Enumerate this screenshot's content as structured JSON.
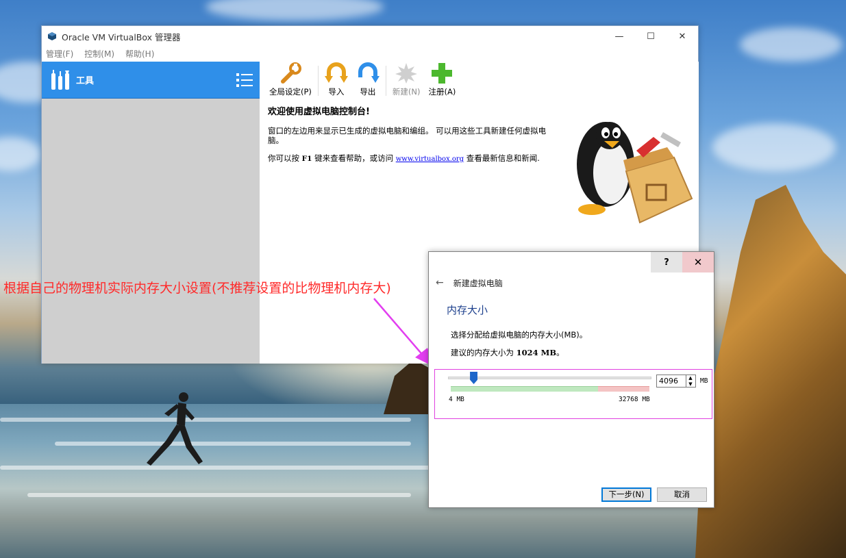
{
  "window": {
    "title": "Oracle VM VirtualBox 管理器",
    "controls": {
      "minimize": "—",
      "maximize": "☐",
      "close": "✕"
    }
  },
  "menubar": {
    "items": [
      "管理(F)",
      "控制(M)",
      "帮助(H)"
    ]
  },
  "sidebar": {
    "tools_label": "工具"
  },
  "toolbar": {
    "preferences": "全局设定(P)",
    "import": "导入",
    "export": "导出",
    "new": "新建(N)",
    "add": "注册(A)"
  },
  "welcome": {
    "heading": "欢迎使用虚拟电脑控制台!",
    "para1": "窗口的左边用来显示已生成的虚拟电脑和编组。 可以用这些工具新建任何虚拟电脑。",
    "para2_prefix": "你可以按",
    "para2_key": "F1",
    "para2_mid": "键来查看帮助，或访问",
    "para2_link": "www.virtualbox.org",
    "para2_suffix": "查看最新信息和新闻."
  },
  "annotation": {
    "text": "根据自己的物理机实际内存大小设置(不推荐设置的比物理机内存大)"
  },
  "dialog": {
    "help": "?",
    "close": "✕",
    "back": "←",
    "nav_title": "新建虚拟电脑",
    "heading": "内存大小",
    "description": "选择分配给虚拟电脑的内存大小(MB)。",
    "recommend_prefix": "建议的内存大小为",
    "recommend_value": "1024 MB",
    "recommend_suffix": "。",
    "memory_value": "4096",
    "memory_unit": "MB",
    "range_min": "4 MB",
    "range_max": "32768 MB",
    "next_button": "下一步(N)",
    "cancel_button": "取消"
  },
  "slider": {
    "min": 4,
    "max": 32768,
    "value": 4096
  },
  "colors": {
    "sidebar_selected": "#2f8fe9",
    "annotation": "#ff2a2a",
    "highlight_box": "#e040e0",
    "heading_blue": "#1c3f8c"
  }
}
